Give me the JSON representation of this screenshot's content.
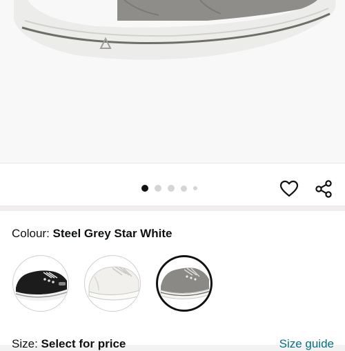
{
  "product": {
    "colour_label": "Colour:",
    "colour_value": "Steel Grey Star White",
    "size_label": "Size:",
    "size_value": "Select for price",
    "size_guide_label": "Size guide"
  },
  "gallery": {
    "slide_count": 5,
    "active_index": 0
  },
  "icons": {
    "wishlist": "heart-icon",
    "share": "share-icon"
  },
  "swatches": [
    {
      "name": "Black",
      "color": "#1c1c1c",
      "selected": false
    },
    {
      "name": "White",
      "color": "#f1f0ec",
      "selected": false
    },
    {
      "name": "Steel Grey Star White",
      "color": "#8a8986",
      "selected": true
    }
  ],
  "colors": {
    "link": "#007185",
    "text": "#0f1111"
  }
}
